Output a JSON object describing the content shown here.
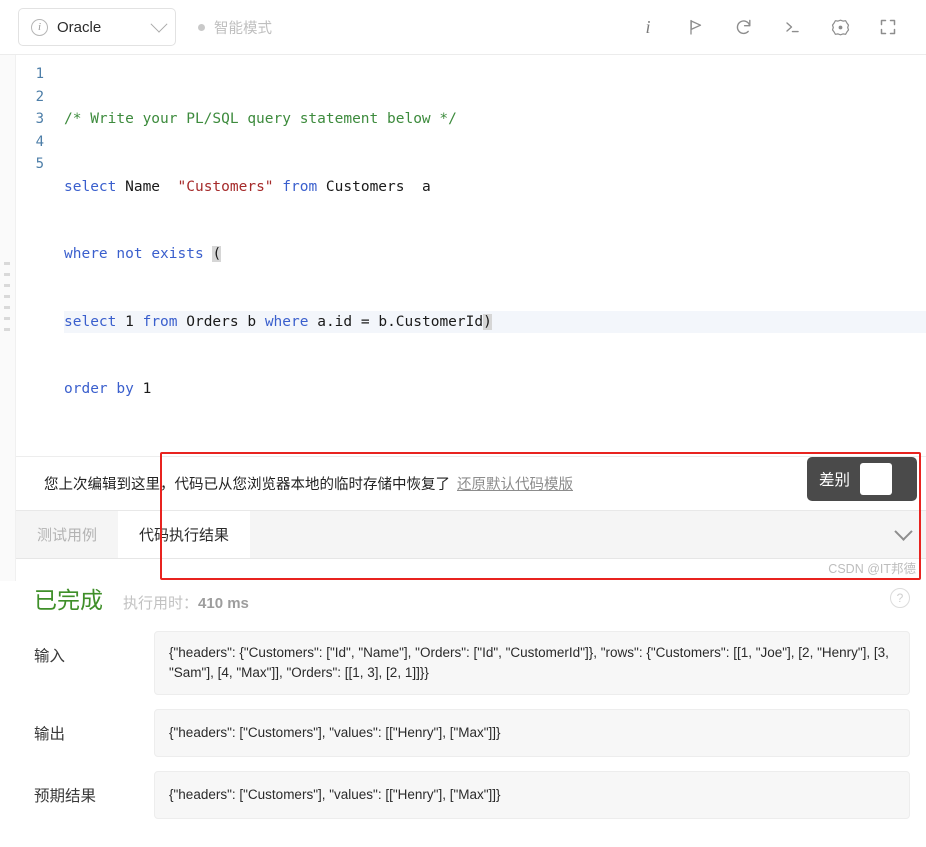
{
  "toolbar": {
    "db_label": "Oracle",
    "db_info_icon": "info-circle-icon",
    "db_chevron_icon": "chevron-down-icon",
    "mode_label": "智能模式",
    "actions": [
      {
        "name": "info-icon",
        "glyph": "i"
      },
      {
        "name": "run-flag-icon",
        "glyph": "flag"
      },
      {
        "name": "reset-undo-icon",
        "glyph": "undo"
      },
      {
        "name": "console-icon",
        "glyph": "terminal"
      },
      {
        "name": "settings-gear-icon",
        "glyph": "gear"
      },
      {
        "name": "fullscreen-icon",
        "glyph": "expand"
      }
    ]
  },
  "editor": {
    "line_numbers": [
      "1",
      "2",
      "3",
      "4",
      "5"
    ],
    "lines": [
      "/* Write your PL/SQL query statement below */",
      "select Name  \"Customers\" from Customers  a",
      "where not exists (",
      "select 1 from Orders b where a.id = b.CustomerId)",
      "order by 1"
    ]
  },
  "notice": {
    "text": "您上次编辑到这里，代码已从您浏览器本地的临时存储中恢复了",
    "link": "还原默认代码模版",
    "close_icon": "close-icon"
  },
  "tabs": {
    "items": [
      {
        "label": "测试用例",
        "active": false
      },
      {
        "label": "代码执行结果",
        "active": true
      }
    ],
    "collapse_icon": "chevron-down-icon"
  },
  "result": {
    "status": "已完成",
    "time_prefix": "执行用时：",
    "time_value": "410 ms",
    "help_icon": "question-mark-icon",
    "rows": [
      {
        "label": "输入",
        "value": "{\"headers\": {\"Customers\": [\"Id\", \"Name\"], \"Orders\": [\"Id\", \"CustomerId\"]}, \"rows\": {\"Customers\": [[1, \"Joe\"], [2, \"Henry\"], [3, \"Sam\"], [4, \"Max\"]], \"Orders\": [[1, 3], [2, 1]]}}"
      },
      {
        "label": "输出",
        "value": "{\"headers\": [\"Customers\"], \"values\": [[\"Henry\"], [\"Max\"]]}"
      },
      {
        "label": "预期结果",
        "value": "{\"headers\": [\"Customers\"], \"values\": [[\"Henry\"], [\"Max\"]]}"
      }
    ],
    "diff": {
      "label": "差别",
      "toggle_state": "off"
    }
  },
  "watermark": "CSDN @IT邦德",
  "colors": {
    "accent_green": "#3f8f29",
    "annotation_red": "#e8231f",
    "tooltip_dark": "#4a4a4a",
    "comment_green": "#3d8b3d",
    "keyword_blue": "#3a5fcd",
    "string_red": "#a52a2a",
    "lineno_blue": "#4d7ea8"
  }
}
